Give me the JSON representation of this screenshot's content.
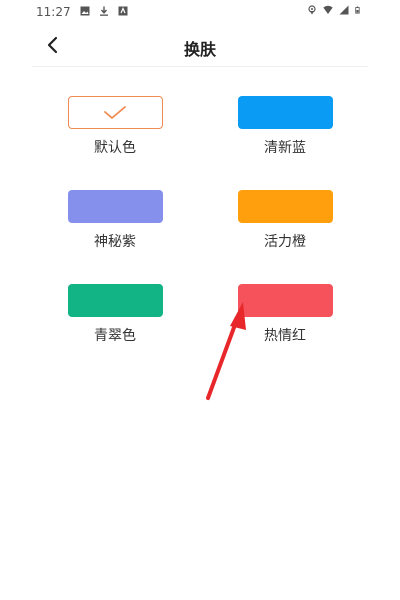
{
  "status_bar": {
    "time": "11:27",
    "left_icons": [
      "image-icon",
      "download-icon",
      "app-icon"
    ],
    "right_icons": [
      "location-icon",
      "wifi-icon",
      "signal-icon",
      "battery-icon"
    ]
  },
  "header": {
    "title": "换肤",
    "back_icon": "chevron-left-icon"
  },
  "themes": [
    {
      "label": "默认色",
      "color": "#ffffff",
      "selected": true
    },
    {
      "label": "清新蓝",
      "color": "#0a9cf5",
      "selected": false
    },
    {
      "label": "神秘紫",
      "color": "#8590ec",
      "selected": false
    },
    {
      "label": "活力橙",
      "color": "#ff9f0d",
      "selected": false
    },
    {
      "label": "青翠色",
      "color": "#12b385",
      "selected": false
    },
    {
      "label": "热情红",
      "color": "#f5525b",
      "selected": false
    }
  ],
  "colors": {
    "selected_border": "#f08a50",
    "annotation_arrow": "#e8272b"
  }
}
